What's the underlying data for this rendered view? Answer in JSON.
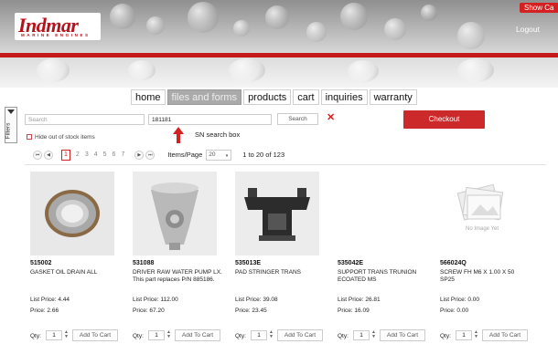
{
  "header": {
    "logo_text": "Indmar",
    "logo_subtitle": "MARINE ENGINES",
    "show_cart": "Show Ca",
    "logout": "Logout",
    "accent": "#c41a1a"
  },
  "nav": {
    "items": [
      {
        "label": "home",
        "active": false
      },
      {
        "label": "files and forms",
        "active": true
      },
      {
        "label": "products",
        "active": false
      },
      {
        "label": "cart",
        "active": false
      },
      {
        "label": "inquiries",
        "active": false
      },
      {
        "label": "warranty",
        "active": false
      }
    ]
  },
  "filters": {
    "label": "Filters"
  },
  "search": {
    "placeholder": "Search",
    "sn_value": "181181",
    "button": "Search",
    "sn_annotation": "SN search box"
  },
  "checkout": {
    "label": "Checkout"
  },
  "stock": {
    "label": "Hide out of stock items"
  },
  "pager": {
    "pages": [
      "1",
      "2",
      "3",
      "4",
      "5",
      "6",
      "7"
    ],
    "current": "1",
    "items_per_page_label": "Items/Page",
    "items_per_page_value": "20",
    "range": "1 to 20 of 123"
  },
  "products": [
    {
      "number": "515002",
      "description": "GASKET OIL DRAIN ALL",
      "list_price": "List Price: 4.44",
      "price": "Price: 2.66",
      "qty_label": "Qty:",
      "qty": "1",
      "add_label": "Add To Cart",
      "image": "washer"
    },
    {
      "number": "531088",
      "description": "DRIVER RAW WATER PUMP LX. This part replaces P/N 885186.",
      "list_price": "List Price: 112.00",
      "price": "Price: 67.20",
      "qty_label": "Qty:",
      "qty": "1",
      "add_label": "Add To Cart",
      "image": "pump-driver"
    },
    {
      "number": "535013E",
      "description": "PAD STRINGER TRANS",
      "list_price": "List Price: 39.08",
      "price": "Price: 23.45",
      "qty_label": "Qty:",
      "qty": "1",
      "add_label": "Add To Cart",
      "image": "stringer-pad"
    },
    {
      "number": "535042E",
      "description": "SUPPORT TRANS TRUNION ECOATED MS",
      "list_price": "List Price: 26.81",
      "price": "Price: 16.09",
      "qty_label": "Qty:",
      "qty": "1",
      "add_label": "Add To Cart",
      "image": "none"
    },
    {
      "number": "566024Q",
      "description": "SCREW FH M6 X 1.00 X 50 SP25",
      "list_price": "List Price: 0.00",
      "price": "Price: 0.00",
      "qty_label": "Qty:",
      "qty": "1",
      "add_label": "Add To Cart",
      "image": "no-image",
      "no_image_text": "No Image Yet"
    }
  ]
}
